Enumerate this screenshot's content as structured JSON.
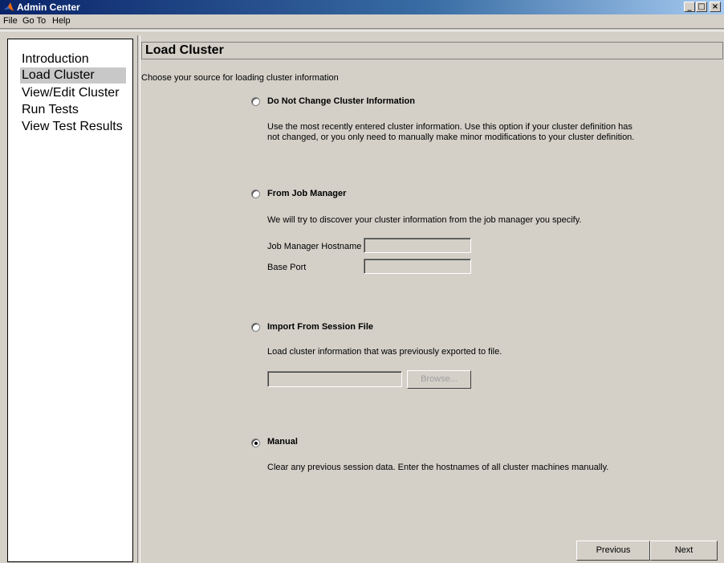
{
  "window": {
    "title": "Admin Center",
    "minimize": "_",
    "maximize": "□",
    "close": "×"
  },
  "menu": {
    "file": "File",
    "goto": "Go To",
    "help": "Help"
  },
  "sidebar": {
    "items": [
      {
        "label": "Introduction"
      },
      {
        "label": "Load Cluster"
      },
      {
        "label": "View/Edit Cluster"
      },
      {
        "label": "Run Tests"
      },
      {
        "label": "View Test Results"
      }
    ]
  },
  "page": {
    "title": "Load Cluster",
    "prompt": "Choose your source for loading cluster information",
    "options": {
      "no_change": {
        "title": "Do Not Change Cluster Information",
        "desc_line1": "Use the most recently entered cluster information. Use this option if your cluster definition has",
        "desc_line2": "not changed, or you only need to manually make minor modifications to your cluster definition."
      },
      "job_manager": {
        "title": "From Job Manager",
        "desc": "We will try to discover your cluster information from the job manager you specify.",
        "hostname_label": "Job Manager Hostname",
        "hostname_value": "",
        "port_label": "Base Port",
        "port_value": ""
      },
      "session_file": {
        "title": "Import From Session File",
        "desc": "Load cluster information that was previously exported to file.",
        "file_value": "",
        "browse_label": "Browse..."
      },
      "manual": {
        "title": "Manual",
        "desc": "Clear any previous session data. Enter the hostnames of all cluster machines manually.",
        "selected": true
      }
    }
  },
  "footer": {
    "previous": "Previous",
    "next": "Next"
  }
}
